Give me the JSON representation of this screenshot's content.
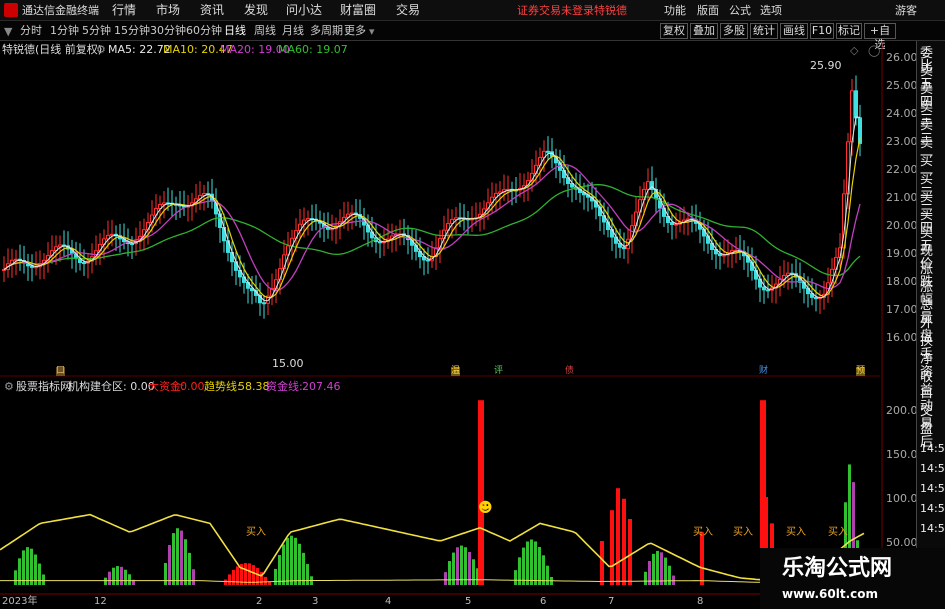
{
  "menubar": {
    "app_title": "通达信金融终端",
    "menus": [
      "行情",
      "市场",
      "资讯",
      "发现",
      "问小达",
      "财富圈",
      "交易"
    ],
    "login_notice": "证券交易未登录",
    "stock_name": "特锐德",
    "right_menus": [
      "功能",
      "版面",
      "公式",
      "选项"
    ],
    "guest": "游客"
  },
  "timeframes": [
    "分时",
    "1分钟",
    "5分钟",
    "15分钟",
    "30分钟",
    "60分钟",
    "日线",
    "周线",
    "月线",
    "多周期",
    "更多"
  ],
  "active_timeframe": "日线",
  "right_toolbar": [
    "复权",
    "叠加",
    "多股",
    "统计",
    "画线",
    "F10",
    "标记",
    "+自选"
  ],
  "ma_legend": {
    "stock": "特锐德(日线 前复权)",
    "items": [
      {
        "label": "MA5: 22.72",
        "color": "#e6e6e6"
      },
      {
        "label": "MA10: 20.47",
        "color": "#e6d200"
      },
      {
        "label": "MA20: 19.00",
        "color": "#d040d0"
      },
      {
        "label": "MA60: 19.07",
        "color": "#30c030"
      }
    ]
  },
  "price_axis": [
    "26.00",
    "25.00",
    "24.00",
    "23.00",
    "22.00",
    "21.00",
    "20.00",
    "19.00",
    "18.00",
    "17.00",
    "16.00"
  ],
  "price_annotations": {
    "high": "25.90",
    "low": "15.00"
  },
  "event_markers": [
    {
      "label": "口",
      "color": "#d9b46a"
    },
    {
      "label": "温",
      "color": "#ffd24a"
    },
    {
      "label": "评",
      "color": "#60d060"
    },
    {
      "label": "债",
      "color": "#d04040"
    },
    {
      "label": "财",
      "color": "#4a90e0"
    },
    {
      "label": "预",
      "color": "#ffd24a"
    }
  ],
  "indicator": {
    "name": "股票指标网",
    "title": "机构建仓区: 0.00",
    "items": [
      {
        "label": "大资金:",
        "value": "0.00",
        "color": "#ff2020"
      },
      {
        "label": "趋势线:",
        "value": "58.38",
        "color": "#e6d200"
      },
      {
        "label": "资金线:",
        "value": "207.46",
        "color": "#d040d0"
      }
    ],
    "axis": [
      "200.0",
      "150.0",
      "100.0",
      "50.00"
    ],
    "buy_label": "买入"
  },
  "date_axis": [
    "2023年",
    "12",
    "2",
    "3",
    "4",
    "5",
    "6",
    "7",
    "8"
  ],
  "right_panel": [
    "委比",
    "卖五",
    "卖四",
    "卖三",
    "卖二",
    "卖一",
    "买一",
    "买二",
    "买三",
    "买四",
    "买五",
    "现价",
    "涨跌",
    "涨幅",
    "总量",
    "外盘",
    "换手",
    "净资",
    "收益",
    "自动",
    "交易",
    "盘后"
  ],
  "right_panel_times": [
    "14:5",
    "14:5",
    "14:5",
    "14:5",
    "14:5"
  ],
  "watermark": {
    "title": "乐淘公式网",
    "url": "www.60lt.com"
  }
}
